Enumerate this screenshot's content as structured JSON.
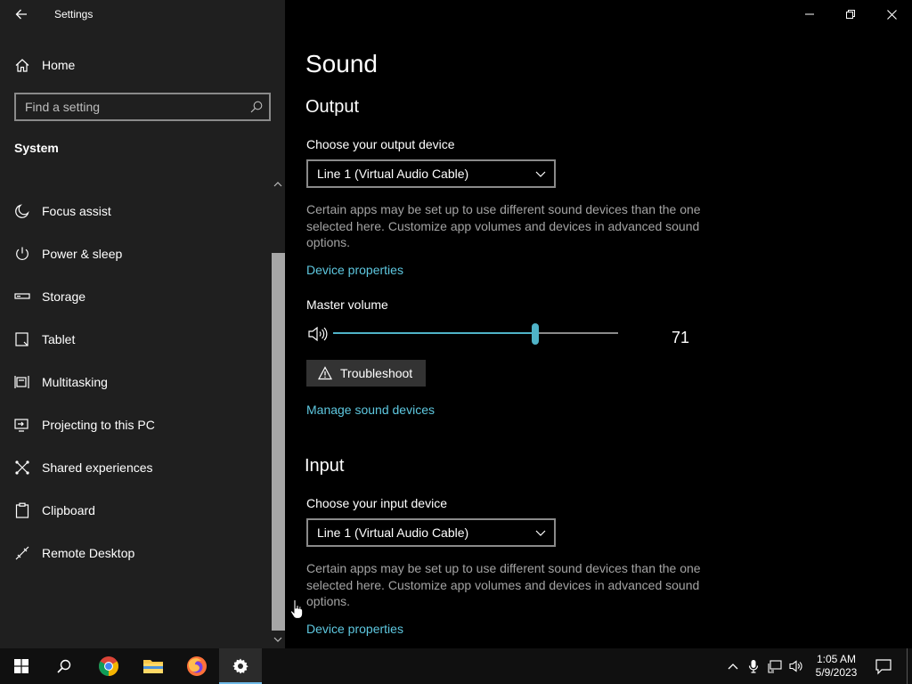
{
  "app": {
    "title": "Settings"
  },
  "sidebar": {
    "home_label": "Home",
    "search_placeholder": "Find a setting",
    "section_title": "System",
    "items": [
      {
        "label": "Focus assist",
        "icon": "moon-icon"
      },
      {
        "label": "Power & sleep",
        "icon": "power-icon"
      },
      {
        "label": "Storage",
        "icon": "storage-icon"
      },
      {
        "label": "Tablet",
        "icon": "tablet-icon"
      },
      {
        "label": "Multitasking",
        "icon": "multitasking-icon"
      },
      {
        "label": "Projecting to this PC",
        "icon": "projecting-icon"
      },
      {
        "label": "Shared experiences",
        "icon": "shared-experiences-icon"
      },
      {
        "label": "Clipboard",
        "icon": "clipboard-icon"
      },
      {
        "label": "Remote Desktop",
        "icon": "remote-desktop-icon"
      }
    ]
  },
  "main": {
    "page_title": "Sound",
    "output": {
      "heading": "Output",
      "device_label": "Choose your output device",
      "device_value": "Line 1 (Virtual Audio Cable)",
      "description": "Certain apps may be set up to use different sound devices than the one selected here. Customize app volumes and devices in advanced sound options.",
      "device_properties_link": "Device properties",
      "master_volume_label": "Master volume",
      "master_volume_value": 71,
      "master_volume_text": "71",
      "troubleshoot_label": "Troubleshoot",
      "manage_devices_link": "Manage sound devices"
    },
    "input": {
      "heading": "Input",
      "device_label": "Choose your input device",
      "device_value": "Line 1 (Virtual Audio Cable)",
      "description": "Certain apps may be set up to use different sound devices than the one selected here. Customize app volumes and devices in advanced sound options.",
      "device_properties_link": "Device properties"
    }
  },
  "taskbar": {
    "time": "1:05 AM",
    "date": "5/9/2023",
    "accent_color": "#6fb9e6"
  },
  "colors": {
    "accent": "#4fb3c8",
    "link": "#5ec8e0",
    "sidebar_bg": "#1f1f1f",
    "main_bg": "#000000"
  }
}
